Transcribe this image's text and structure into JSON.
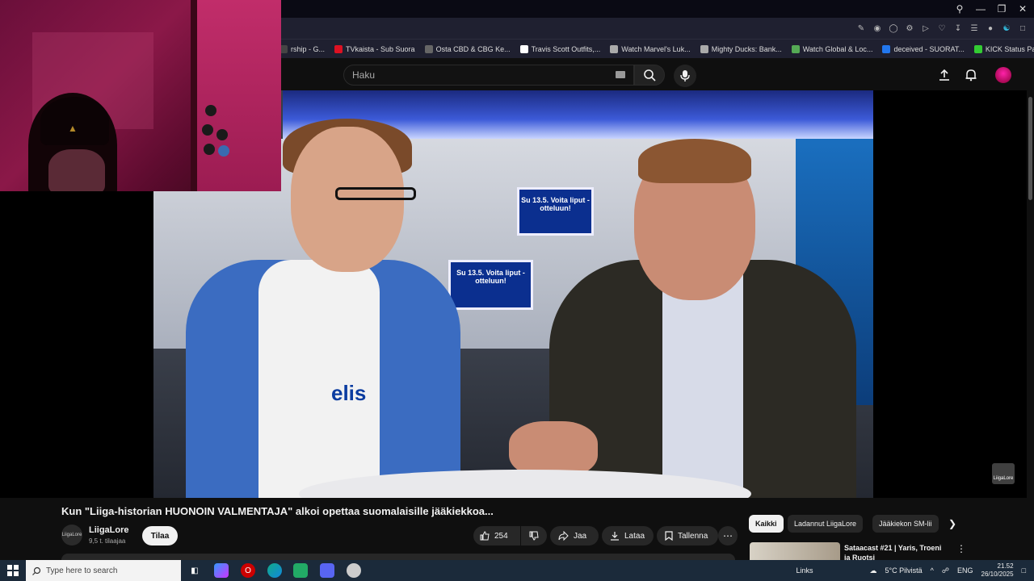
{
  "browser": {
    "bookmarks": [
      {
        "label": "rship - G...",
        "color": "#444"
      },
      {
        "label": "TVkaista - Sub Suora",
        "color": "#d12"
      },
      {
        "label": "Osta CBD & CBG Ke...",
        "color": "#666"
      },
      {
        "label": "Travis Scott Outfits,...",
        "color": "#fff"
      },
      {
        "label": "Watch Marvel's Luk...",
        "color": "#aaa"
      },
      {
        "label": "Mighty Ducks: Bank...",
        "color": "#aaa"
      },
      {
        "label": "Watch Global & Loc...",
        "color": "#5a5"
      },
      {
        "label": "deceived - SUORAT...",
        "color": "#27e"
      },
      {
        "label": "KICK Status Page",
        "color": "#3c3"
      }
    ]
  },
  "header": {
    "search_placeholder": "Haku"
  },
  "video": {
    "title": "Kun \"Liiga-historian HUONOIN VALMENTAJA\" alkoi opettaa suomalaisille jääkiekkoa...",
    "channel_name": "LiigaLore",
    "channel_avatar_text": "LiigaLore",
    "subscribers": "9,5 t. tilaajaa",
    "subscribe_label": "Tilaa",
    "likes": "254",
    "share_label": "Jaa",
    "download_label": "Lataa",
    "save_label": "Tallenna",
    "watermark": "LiigaLore",
    "scene_logo_text": "elis",
    "sign_text_1": "Su 13.5. Voita liput -otteluun!",
    "sign_text_2": "Su 13.5. Voita liput -otteluun!"
  },
  "chips": [
    "Kaikki",
    "Ladannut LiigaLore",
    "Jääkiekon SM-lii"
  ],
  "recommendation": {
    "title": "Sataacast #21 | Yaris, Troeni ja Ruotsi"
  },
  "taskbar": {
    "search_placeholder": "Type here to search",
    "links_label": "Links",
    "weather": "5°C Pilvistä",
    "language": "ENG",
    "time": "21.52",
    "date": "26/10/2025"
  }
}
